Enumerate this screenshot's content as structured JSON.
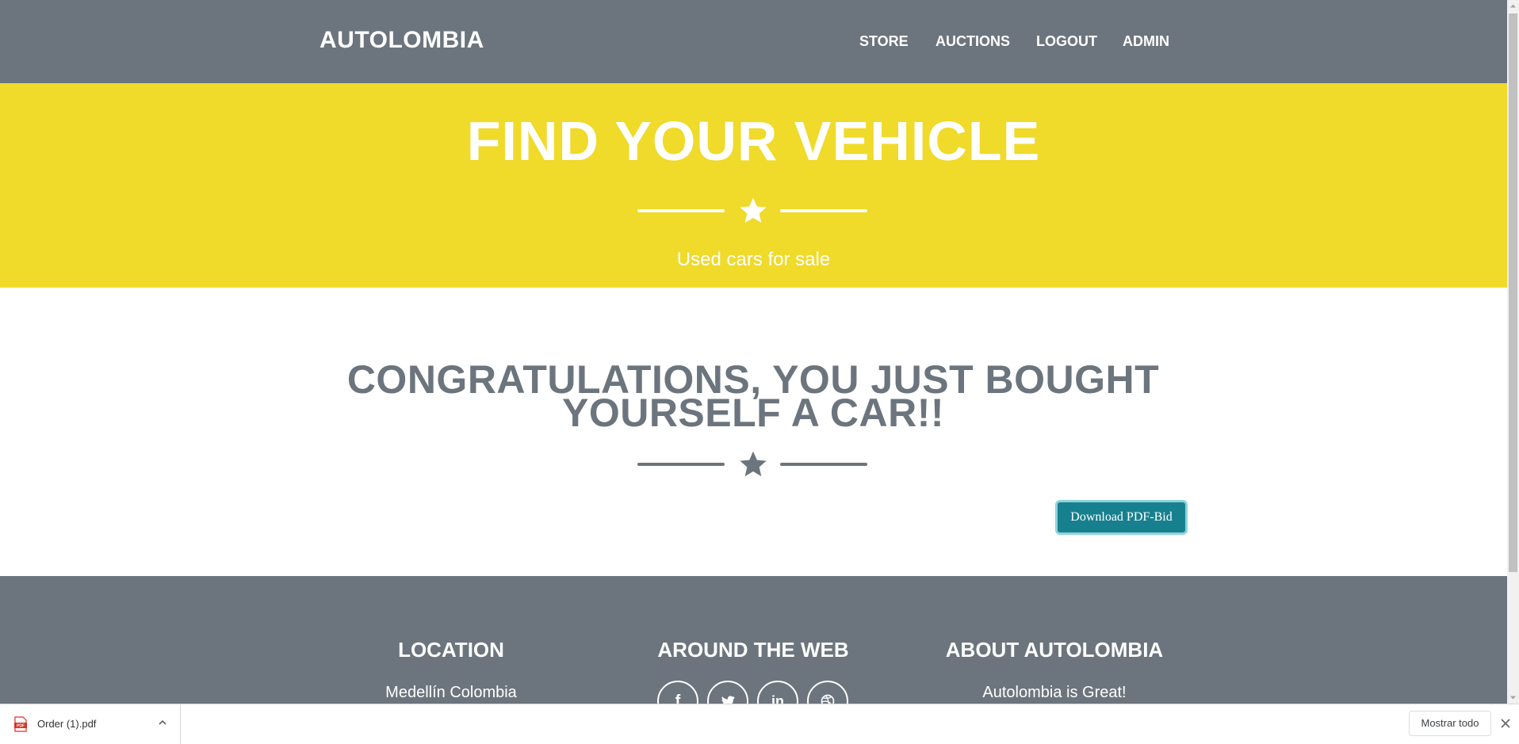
{
  "navbar": {
    "brand": "AUTOLOMBIA",
    "items": [
      {
        "label": "STORE"
      },
      {
        "label": "AUCTIONS"
      },
      {
        "label": "LOGOUT"
      },
      {
        "label": "ADMIN"
      }
    ]
  },
  "masthead": {
    "title": "FIND YOUR VEHICLE",
    "subtitle": "Used cars for sale",
    "divider_icon": "star-icon"
  },
  "content": {
    "heading_line1": "CONGRATULATIONS, YOU JUST BOUGHT",
    "heading_line2": "YOURSELF A CAR!!",
    "divider_icon": "star-icon",
    "download_button": "Download PDF-Bid"
  },
  "footer": {
    "location": {
      "title": "LOCATION",
      "text": "Medellín Colombia"
    },
    "web": {
      "title": "AROUND THE WEB",
      "icons": [
        "facebook-icon",
        "twitter-icon",
        "linkedin-icon",
        "dribbble-icon"
      ]
    },
    "about": {
      "title": "ABOUT AUTOLOMBIA",
      "text": "Autolombia is Great!"
    }
  },
  "download_shelf": {
    "file_name": "Order (1).pdf",
    "show_all": "Mostrar todo"
  },
  "colors": {
    "navbar": "#6c757d",
    "masthead": "#f0da2a",
    "heading": "#6c757d",
    "button": "#17808f"
  }
}
